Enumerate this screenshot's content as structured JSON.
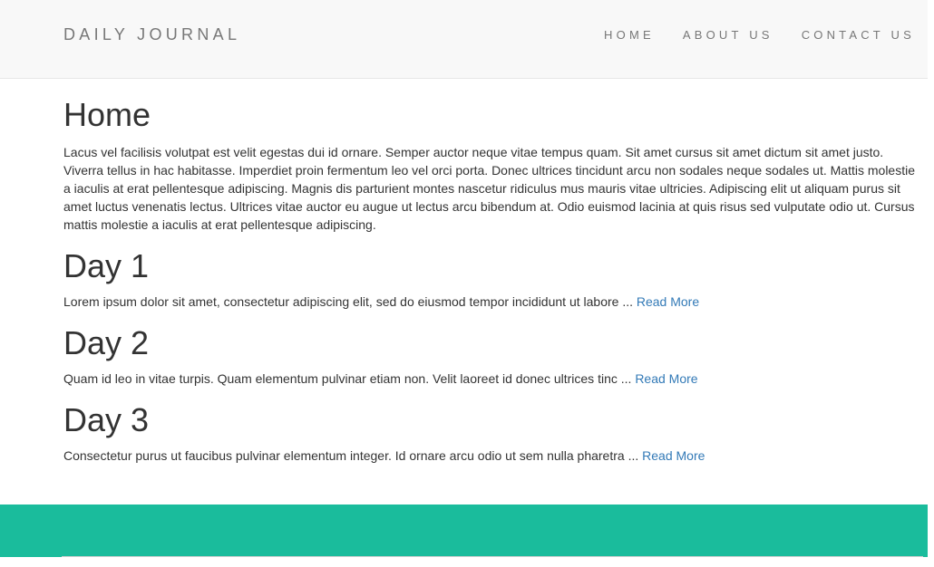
{
  "navbar": {
    "brand": "DAILY JOURNAL",
    "links": [
      "HOME",
      "ABOUT US",
      "CONTACT US"
    ]
  },
  "home": {
    "title": "Home",
    "intro": "Lacus vel facilisis volutpat est velit egestas dui id ornare. Semper auctor neque vitae tempus quam. Sit amet cursus sit amet dictum sit amet justo. Viverra tellus in hac habitasse. Imperdiet proin fermentum leo vel orci porta. Donec ultrices tincidunt arcu non sodales neque sodales ut. Mattis molestie a iaculis at erat pellentesque adipiscing. Magnis dis parturient montes nascetur ridiculus mus mauris vitae ultricies. Adipiscing elit ut aliquam purus sit amet luctus venenatis lectus. Ultrices vitae auctor eu augue ut lectus arcu bibendum at. Odio euismod lacinia at quis risus sed vulputate odio ut. Cursus mattis molestie a iaculis at erat pellentesque adipiscing."
  },
  "posts": [
    {
      "title": "Day 1",
      "excerpt": "Lorem ipsum dolor sit amet, consectetur adipiscing elit, sed do eiusmod tempor incididunt ut labore ... ",
      "read_more": "Read More"
    },
    {
      "title": "Day 2",
      "excerpt": "Quam id leo in vitae turpis. Quam elementum pulvinar etiam non. Velit laoreet id donec ultrices tinc ... ",
      "read_more": "Read More"
    },
    {
      "title": "Day 3",
      "excerpt": "Consectetur purus ut faucibus pulvinar elementum integer. Id ornare arcu odio ut sem nulla pharetra ... ",
      "read_more": "Read More"
    }
  ],
  "colors": {
    "navbar_bg": "#f8f8f8",
    "footer_bg": "#1abc9c",
    "link": "#337ab7"
  }
}
